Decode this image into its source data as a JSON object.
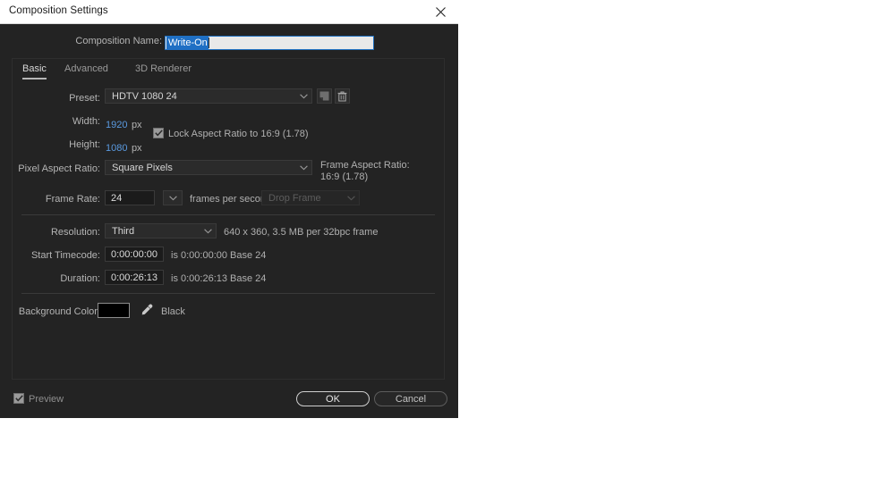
{
  "window": {
    "title": "Composition Settings",
    "close_icon": "close-icon"
  },
  "comp_name": {
    "label": "Composition Name:",
    "value": "Write-On",
    "placeholder": ""
  },
  "tabs": [
    {
      "label": "Basic",
      "active": true
    },
    {
      "label": "Advanced",
      "active": false
    },
    {
      "label": "3D Renderer",
      "active": false
    }
  ],
  "basic": {
    "preset": {
      "label": "Preset:",
      "value": "HDTV 1080 24",
      "save_icon": "save-preset-icon",
      "delete_icon": "trash-icon"
    },
    "width": {
      "label": "Width:",
      "value": "1920",
      "unit": "px"
    },
    "height": {
      "label": "Height:",
      "value": "1080",
      "unit": "px"
    },
    "lock_aspect": {
      "label": "Lock Aspect Ratio to 16:9 (1.78)",
      "checked": true
    },
    "pixel_aspect_ratio": {
      "label": "Pixel Aspect Ratio:",
      "value": "Square Pixels"
    },
    "frame_aspect_ratio": {
      "label": "Frame Aspect Ratio:",
      "value": "16:9 (1.78)"
    },
    "frame_rate": {
      "label": "Frame Rate:",
      "value": "24",
      "suffix": "frames per second",
      "drop_frame": "Drop Frame",
      "drop_frame_disabled": true
    },
    "resolution": {
      "label": "Resolution:",
      "value": "Third",
      "info": "640 x 360, 3.5 MB per 32bpc frame"
    },
    "start_timecode": {
      "label": "Start Timecode:",
      "value": "0:00:00:00",
      "info": "is 0:00:00:00  Base 24"
    },
    "duration": {
      "label": "Duration:",
      "value": "0:00:26:13",
      "info": "is 0:00:26:13  Base 24"
    },
    "background_color": {
      "label": "Background Color:",
      "swatch_hex": "#000000",
      "name": "Black",
      "eyedropper_icon": "eyedropper-icon"
    }
  },
  "footer": {
    "preview": {
      "label": "Preview",
      "checked": true
    },
    "ok_label": "OK",
    "cancel_label": "Cancel"
  },
  "colors": {
    "dialog_bg": "#232323",
    "titlebar_bg": "#ffffff",
    "accent_blue": "#5a9ae0",
    "selection_blue": "#1f6fc4",
    "label_gray": "#b4b4b4"
  }
}
